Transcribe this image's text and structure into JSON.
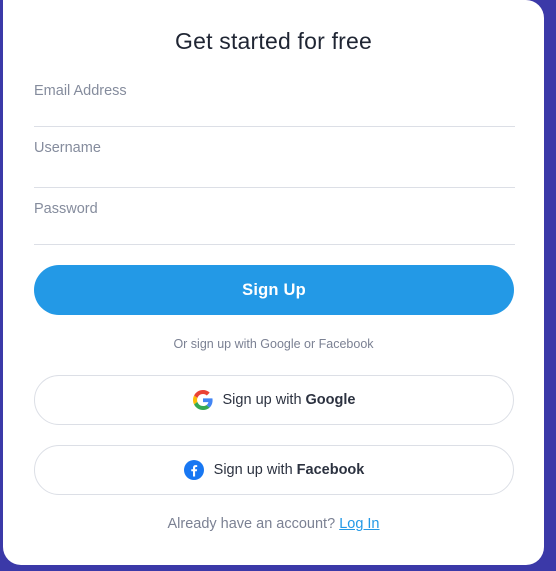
{
  "form": {
    "title": "Get started for free",
    "email_placeholder": "Email Address",
    "username_placeholder": "Username",
    "password_placeholder": "Password",
    "submit_label": "Sign Up",
    "or_text": "Or sign up with Google or Facebook",
    "google_button": {
      "prefix": "Sign up with",
      "brand": "Google",
      "icon": "google-icon"
    },
    "facebook_button": {
      "prefix": "Sign up with",
      "brand": "Facebook",
      "icon": "facebook-icon"
    },
    "footer_text": "Already have an account?",
    "login_link": "Log In"
  },
  "colors": {
    "background": "#3b39a8",
    "accent": "#2399e6",
    "title": "#1f2533",
    "muted": "#7b8193"
  }
}
